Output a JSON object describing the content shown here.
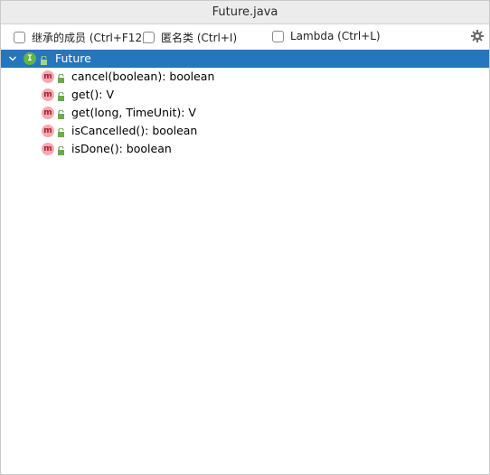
{
  "window": {
    "title": "Future.java"
  },
  "toolbar": {
    "options": [
      {
        "label": "继承的成员 (Ctrl+F12)",
        "checked": false
      },
      {
        "label": "匿名类 (Ctrl+I)",
        "checked": false
      },
      {
        "label": "Lambda (Ctrl+L)",
        "checked": false
      }
    ],
    "settings_icon": "gear-icon"
  },
  "tree": {
    "root": {
      "label": "Future",
      "icon": "interface-icon",
      "icon_letter": "I",
      "expanded": true,
      "selected": true
    },
    "methods": [
      {
        "label": "cancel(boolean): boolean",
        "icon": "method-icon",
        "icon_letter": "m"
      },
      {
        "label": "get(): V",
        "icon": "method-icon",
        "icon_letter": "m"
      },
      {
        "label": "get(long, TimeUnit): V",
        "icon": "method-icon",
        "icon_letter": "m"
      },
      {
        "label": "isCancelled(): boolean",
        "icon": "method-icon",
        "icon_letter": "m"
      },
      {
        "label": "isDone(): boolean",
        "icon": "method-icon",
        "icon_letter": "m"
      }
    ]
  },
  "colors": {
    "selection": "#2675bf",
    "interface_icon": "#62b543",
    "method_icon_bg": "#f5a9b0",
    "method_icon_fg": "#a3202e",
    "public_lock": "#6aab4a"
  }
}
